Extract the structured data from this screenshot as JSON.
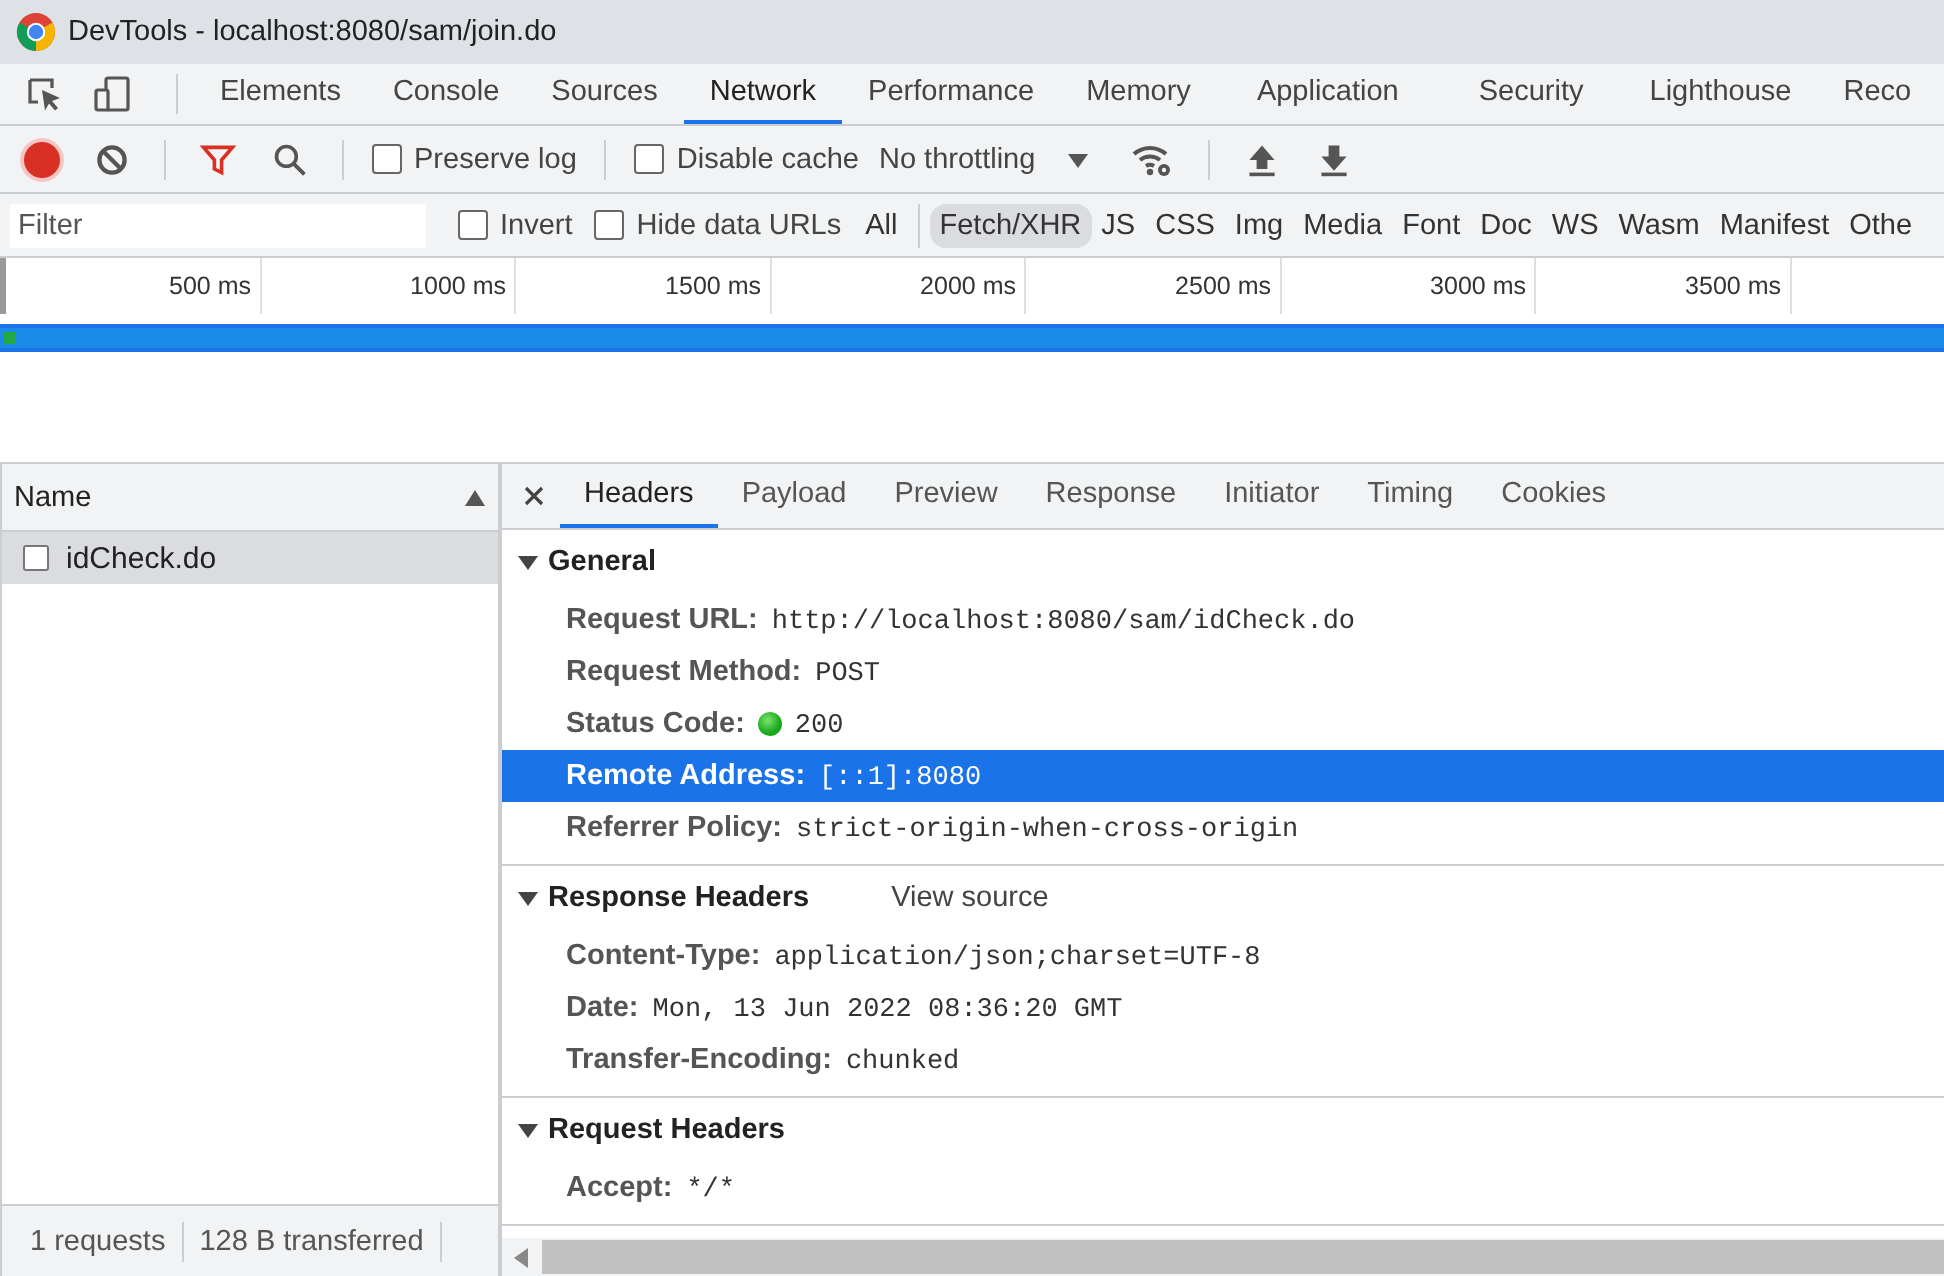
{
  "window": {
    "title": "DevTools - localhost:8080/sam/join.do"
  },
  "main_tabs": [
    {
      "label": "Elements",
      "selected": false
    },
    {
      "label": "Console",
      "selected": false
    },
    {
      "label": "Sources",
      "selected": false
    },
    {
      "label": "Network",
      "selected": true
    },
    {
      "label": "Performance",
      "selected": false
    },
    {
      "label": "Memory",
      "selected": false
    },
    {
      "label": "Application",
      "selected": false
    },
    {
      "label": "Security",
      "selected": false
    },
    {
      "label": "Lighthouse",
      "selected": false
    },
    {
      "label": "Reco",
      "selected": false
    }
  ],
  "toolbar": {
    "recording": true,
    "preserve_log": {
      "label": "Preserve log",
      "checked": false
    },
    "disable_cache": {
      "label": "Disable cache",
      "checked": false
    },
    "throttling": "No throttling"
  },
  "filter_bar": {
    "placeholder": "Filter",
    "invert": {
      "label": "Invert",
      "checked": false
    },
    "hide_data_urls": {
      "label": "Hide data URLs",
      "checked": false
    },
    "types": [
      {
        "label": "All",
        "selected": false
      },
      {
        "label": "Fetch/XHR",
        "selected": true
      },
      {
        "label": "JS",
        "selected": false
      },
      {
        "label": "CSS",
        "selected": false
      },
      {
        "label": "Img",
        "selected": false
      },
      {
        "label": "Media",
        "selected": false
      },
      {
        "label": "Font",
        "selected": false
      },
      {
        "label": "Doc",
        "selected": false
      },
      {
        "label": "WS",
        "selected": false
      },
      {
        "label": "Wasm",
        "selected": false
      },
      {
        "label": "Manifest",
        "selected": false
      },
      {
        "label": "Othe",
        "selected": false
      }
    ]
  },
  "timeline": {
    "ticks": [
      "500 ms",
      "1000 ms",
      "1500 ms",
      "2000 ms",
      "2500 ms",
      "3000 ms",
      "3500 ms"
    ]
  },
  "requests": {
    "column": "Name",
    "items": [
      {
        "name": "idCheck.do",
        "selected": true
      }
    ],
    "summary": [
      "1 requests",
      "128 B transferred"
    ]
  },
  "detail_tabs": [
    {
      "label": "Headers",
      "selected": true
    },
    {
      "label": "Payload",
      "selected": false
    },
    {
      "label": "Preview",
      "selected": false
    },
    {
      "label": "Response",
      "selected": false
    },
    {
      "label": "Initiator",
      "selected": false
    },
    {
      "label": "Timing",
      "selected": false
    },
    {
      "label": "Cookies",
      "selected": false
    }
  ],
  "sections": [
    {
      "title": "General",
      "expanded": true,
      "rows": [
        {
          "kind": "plain",
          "key": "Request URL:",
          "value": "http://localhost:8080/sam/idCheck.do",
          "selected": false
        },
        {
          "kind": "plain",
          "key": "Request Method:",
          "value": "POST",
          "selected": false
        },
        {
          "kind": "status",
          "key": "Status Code:",
          "value": "200",
          "selected": false
        },
        {
          "kind": "plain",
          "key": "Remote Address:",
          "value": "[::1]:8080",
          "selected": true
        },
        {
          "kind": "plain",
          "key": "Referrer Policy:",
          "value": "strict-origin-when-cross-origin",
          "selected": false
        }
      ]
    },
    {
      "title": "Response Headers",
      "expanded": true,
      "link": "View source",
      "rows": [
        {
          "kind": "plain",
          "key": "Content-Type:",
          "value": "application/json;charset=UTF-8",
          "selected": false
        },
        {
          "kind": "plain",
          "key": "Date:",
          "value": "Mon, 13 Jun 2022 08:36:20 GMT",
          "selected": false
        },
        {
          "kind": "plain",
          "key": "Transfer-Encoding:",
          "value": "chunked",
          "selected": false
        }
      ]
    },
    {
      "title": "Request Headers",
      "expanded": true,
      "rows": [
        {
          "kind": "plain",
          "key": "Accept:",
          "value": "*/*",
          "selected": false
        }
      ]
    }
  ]
}
